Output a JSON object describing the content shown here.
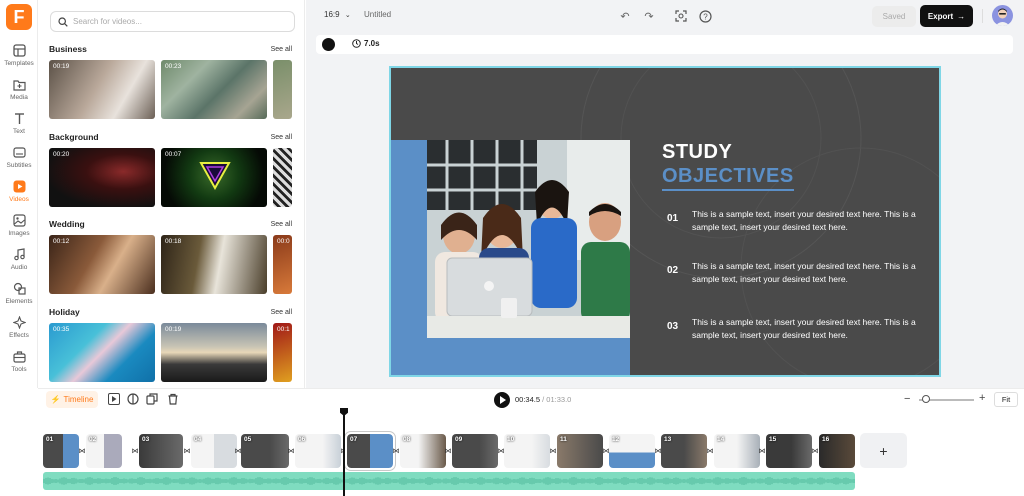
{
  "app": {
    "logo_letter": "F",
    "brand_color": "#ff7a1a"
  },
  "rail": {
    "items": [
      {
        "label": "Templates",
        "icon": "templates-icon"
      },
      {
        "label": "Media",
        "icon": "media-icon"
      },
      {
        "label": "Text",
        "icon": "text-icon"
      },
      {
        "label": "Subtitles",
        "icon": "subtitles-icon"
      },
      {
        "label": "Videos",
        "icon": "videos-icon",
        "active": true
      },
      {
        "label": "Images",
        "icon": "images-icon"
      },
      {
        "label": "Audio",
        "icon": "audio-icon"
      },
      {
        "label": "Elements",
        "icon": "elements-icon"
      },
      {
        "label": "Effects",
        "icon": "effects-icon"
      },
      {
        "label": "Tools",
        "icon": "tools-icon"
      }
    ]
  },
  "panel": {
    "search_placeholder": "Search for videos...",
    "see_all": "See all",
    "categories": [
      {
        "title": "Business",
        "durations": [
          "00:19",
          "00:23",
          ""
        ]
      },
      {
        "title": "Background",
        "durations": [
          "00:20",
          "00:07",
          ""
        ]
      },
      {
        "title": "Wedding",
        "durations": [
          "00:12",
          "00:18",
          "00:0"
        ]
      },
      {
        "title": "Holiday",
        "durations": [
          "00:35",
          "00:19",
          "00:1"
        ]
      }
    ]
  },
  "topbar": {
    "ratio": "16:9",
    "title": "Untitled",
    "saved_label": "Saved",
    "export_label": "Export"
  },
  "subbar": {
    "duration": "7.0s"
  },
  "slide": {
    "title_line1": "STUDY",
    "title_line2": "OBJECTIVES",
    "objectives": [
      {
        "num": "01",
        "text": "This is a sample text, insert your desired text here. This is a sample text, insert your desired text here."
      },
      {
        "num": "02",
        "text": "This is a sample text, insert your desired text here. This is a sample text, insert your desired text here."
      },
      {
        "num": "03",
        "text": "This is a sample text, insert your desired text here. This is a sample text, insert your desired text here."
      }
    ],
    "colors": {
      "background": "#4a4a4a",
      "accent": "#5b8fc7",
      "selection": "#7fd6e6"
    }
  },
  "timeline": {
    "tab_label": "Timeline",
    "current_time": "00:34.5",
    "total_time": "01:33.0",
    "fit_label": "Fit",
    "add_label": "+",
    "clips": [
      "01",
      "02",
      "03",
      "04",
      "05",
      "06",
      "07",
      "08",
      "09",
      "10",
      "11",
      "12",
      "13",
      "14",
      "15",
      "16"
    ]
  }
}
